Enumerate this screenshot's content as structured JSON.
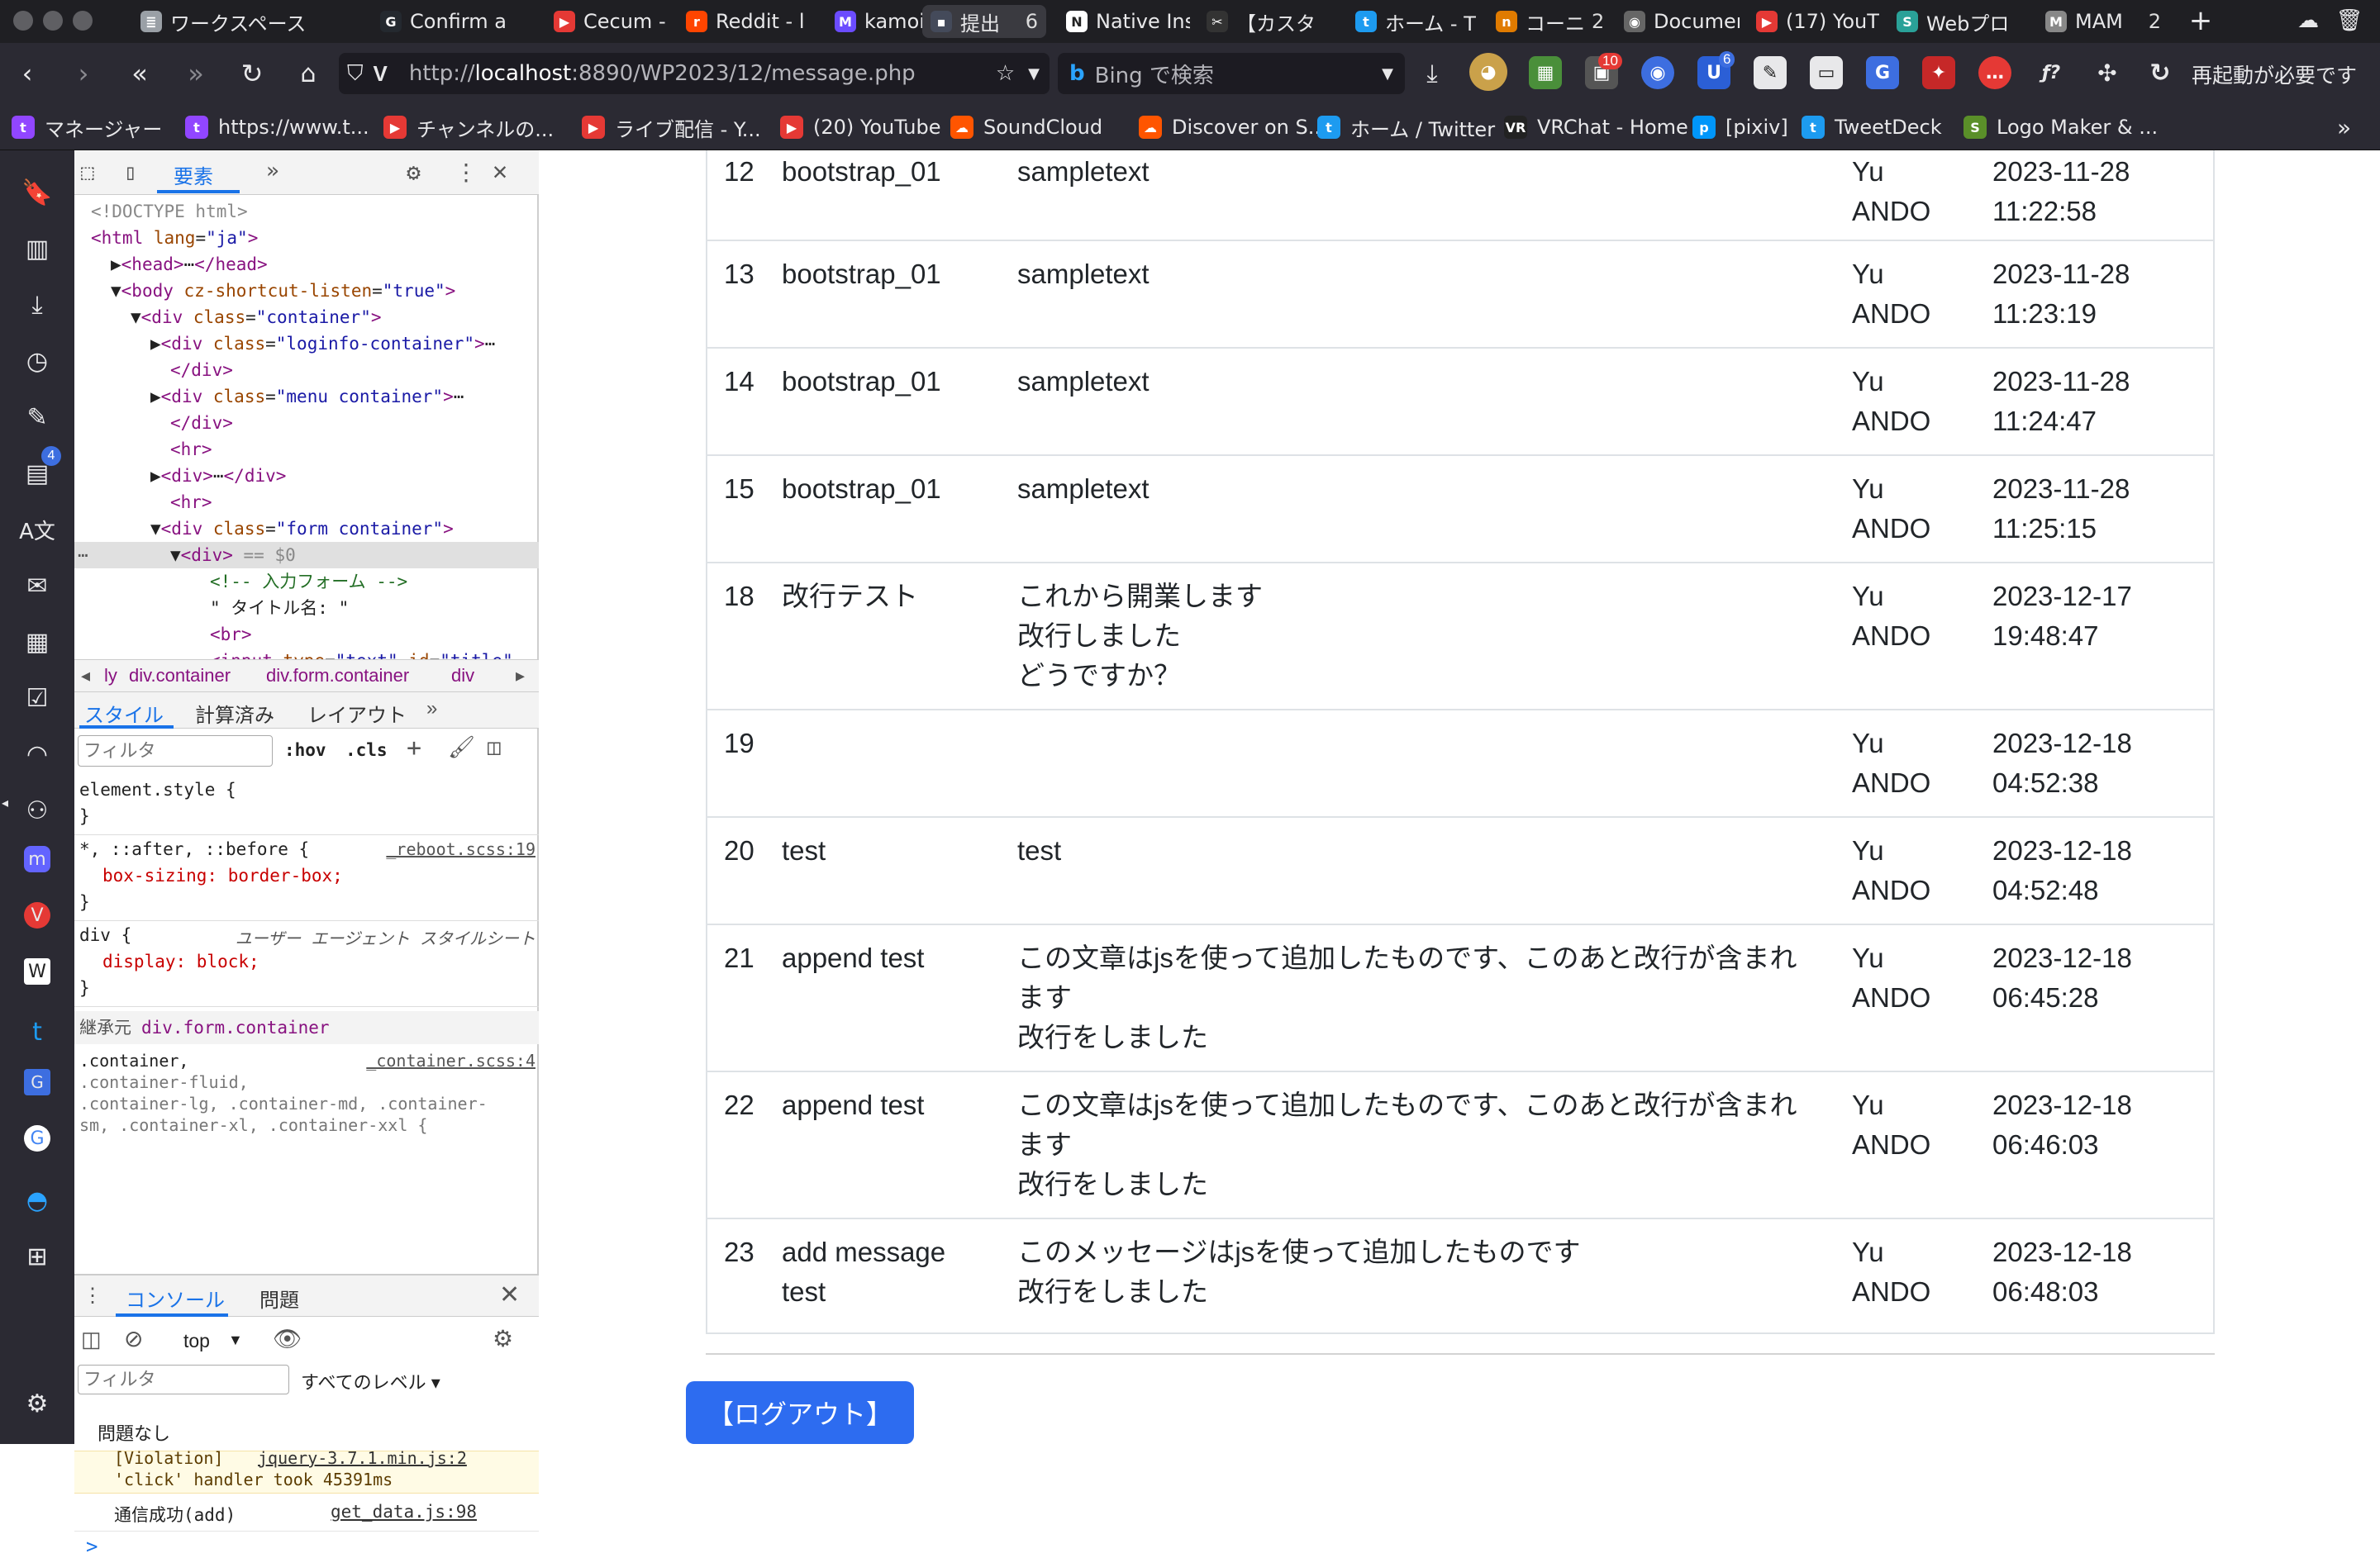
{
  "tabs": [
    {
      "label": "ワークスペース",
      "color": "#9aa0a6",
      "glyph": "≣"
    },
    {
      "label": "Confirm a",
      "color": "#24292f",
      "glyph": "G"
    },
    {
      "label": "Cecum -",
      "color": "#e53935",
      "glyph": "▶"
    },
    {
      "label": "Reddit - l",
      "color": "#ff4500",
      "glyph": "r"
    },
    {
      "label": "kamoi's S",
      "color": "#6b4cff",
      "glyph": "M"
    },
    {
      "label": "提出",
      "count": "6",
      "color": "#444a5a",
      "glyph": "▪",
      "active": true
    },
    {
      "label": "Native Ins",
      "color": "#fff",
      "glyph": "N"
    },
    {
      "label": "【カスタ",
      "color": "#333",
      "glyph": "✂"
    },
    {
      "label": "ホーム - T",
      "color": "#1d9bf0",
      "glyph": "t"
    },
    {
      "label": "コーニ",
      "count": "2",
      "color": "#e07b00",
      "glyph": "n"
    },
    {
      "label": "Documen",
      "color": "#666",
      "glyph": "◉"
    },
    {
      "label": "(17) YouT",
      "color": "#e53935",
      "glyph": "▶"
    },
    {
      "label": "Webプロ",
      "color": "#2aa198",
      "glyph": "S"
    },
    {
      "label": "MAM",
      "count": "2",
      "color": "#888",
      "glyph": "M"
    }
  ],
  "toolbar": {
    "url_prefix": "http://",
    "url_host": "localhost",
    "url_rest": ":8890/WP2023/12/message.php",
    "search_placeholder": "Bing で検索",
    "restart_label": "再起動が必要です",
    "ext_badges": {
      "notif": "10",
      "ublock": "6"
    }
  },
  "bookmarks": [
    {
      "label": "マネージャー",
      "color": "#9146ff",
      "glyph": "t"
    },
    {
      "label": "https://www.t...",
      "color": "#9146ff",
      "glyph": "t"
    },
    {
      "label": "チャンネルの...",
      "color": "#e53935",
      "glyph": "▶"
    },
    {
      "label": "ライブ配信 - Y...",
      "color": "#e53935",
      "glyph": "▶"
    },
    {
      "label": "(20) YouTube",
      "color": "#e53935",
      "glyph": "▶"
    },
    {
      "label": "SoundCloud",
      "color": "#ff5500",
      "glyph": "☁"
    },
    {
      "label": "Discover on S...",
      "color": "#ff5500",
      "glyph": "☁"
    },
    {
      "label": "ホーム / Twitter",
      "color": "#1d9bf0",
      "glyph": "t"
    },
    {
      "label": "VRChat - Home",
      "color": "#222",
      "glyph": "VR"
    },
    {
      "label": "[pixiv]",
      "color": "#0096fa",
      "glyph": "p"
    },
    {
      "label": "TweetDeck",
      "color": "#1d9bf0",
      "glyph": "t"
    },
    {
      "label": "Logo Maker & ...",
      "color": "#5a8f29",
      "glyph": "S"
    }
  ],
  "sidebar": {
    "badge": "4"
  },
  "devtools": {
    "tab_elements": "要素",
    "dom": [
      {
        "indent": 0,
        "html": "<span class='cm' style='color:#888'>&lt;!DOCTYPE html&gt;</span>"
      },
      {
        "indent": 0,
        "html": "<span class='tag'>&lt;html</span> <span class='attr'>lang</span>=<span class='val'>\"ja\"</span><span class='tag'>&gt;</span>"
      },
      {
        "indent": 1,
        "html": "▶<span class='tag'>&lt;head&gt;</span>⋯<span class='tag'>&lt;/head&gt;</span>"
      },
      {
        "indent": 1,
        "html": "▼<span class='tag'>&lt;body</span> <span class='attr'>cz-shortcut-listen</span>=<span class='val'>\"true\"</span><span class='tag'>&gt;</span>"
      },
      {
        "indent": 2,
        "html": "▼<span class='tag'>&lt;div</span> <span class='attr'>class</span>=<span class='val'>\"container\"</span><span class='tag'>&gt;</span>"
      },
      {
        "indent": 3,
        "html": "▶<span class='tag'>&lt;div</span> <span class='attr'>class</span>=<span class='val'>\"loginfo-container\"</span><span class='tag'>&gt;</span>⋯"
      },
      {
        "indent": 4,
        "html": "<span class='tag'>&lt;/div&gt;</span>"
      },
      {
        "indent": 3,
        "html": "▶<span class='tag'>&lt;div</span> <span class='attr'>class</span>=<span class='val'>\"menu container\"</span><span class='tag'>&gt;</span>⋯"
      },
      {
        "indent": 4,
        "html": "<span class='tag'>&lt;/div&gt;</span>"
      },
      {
        "indent": 4,
        "html": "<span class='tag'>&lt;hr&gt;</span>"
      },
      {
        "indent": 3,
        "html": "▶<span class='tag'>&lt;div&gt;</span>⋯<span class='tag'>&lt;/div&gt;</span>"
      },
      {
        "indent": 4,
        "html": "<span class='tag'>&lt;hr&gt;</span>"
      },
      {
        "indent": 3,
        "html": "▼<span class='tag'>&lt;div</span> <span class='attr'>class</span>=<span class='val'>\"form container\"</span><span class='tag'>&gt;</span>"
      },
      {
        "indent": 4,
        "html": "▼<span class='tag'>&lt;div&gt;</span> <span style='color:#888'>== $0</span>",
        "selected": true
      },
      {
        "indent": 6,
        "html": "<span class='cm'>&lt;!-- 入力フォーム --&gt;</span>"
      },
      {
        "indent": 6,
        "html": "\" タイトル名: \""
      },
      {
        "indent": 6,
        "html": "<span class='tag'>&lt;br&gt;</span>"
      },
      {
        "indent": 6,
        "html": "<span class='tag'>&lt;input</span> <span class='attr'>type</span>=<span class='val'>\"text\"</span> <span class='attr'>id</span>=<span class='val'>\"title\"</span>"
      }
    ],
    "breadcrumbs": [
      "ly",
      "div.container",
      "div.form.container",
      "div"
    ],
    "style_tabs": [
      "スタイル",
      "計算済み",
      "レイアウト"
    ],
    "filter_placeholder": "フィルタ",
    "hov": ":hov",
    "cls": ".cls",
    "rules": [
      {
        "sel": "element.style {",
        "src": "",
        "props": [],
        "close": "}"
      },
      {
        "sel": "*, ::after, ::before {",
        "src": "_reboot.scss:19",
        "props": [
          "box-sizing: border-box;"
        ],
        "close": "}"
      },
      {
        "sel": "div {",
        "src": "ユーザー エージェント スタイルシート",
        "props": [
          "display: block;"
        ],
        "close": "}"
      }
    ],
    "inherited_label": "継承元",
    "inherited_from": "div.form.container",
    "container_rule_src": "_container.scss:4",
    "container_rule_lines": [
      ".container,",
      ".container-fluid,",
      ".container-lg, .container-md, .container-",
      "sm, .container-xl, .container-xxl {"
    ],
    "console_tabs": [
      "コンソール",
      "問題"
    ],
    "console_context": "top",
    "console_filter": "フィルタ",
    "console_levels": "すべてのレベル ▾",
    "no_issues": "問題なし",
    "violation_link": "jquery-3.7.1.min.js:2",
    "violation_line1": "[Violation]",
    "violation_line2": "'click' handler took 45391ms",
    "log_text": "通信成功(add)",
    "log_src": "get_data.js:98",
    "prompt": ">"
  },
  "messages": [
    {
      "id": "12",
      "title": "bootstrap_01",
      "message": "sampletext",
      "user": "Yu\nANDO",
      "date": "2023-11-28 11:22:58"
    },
    {
      "id": "13",
      "title": "bootstrap_01",
      "message": "sampletext",
      "user": "Yu\nANDO",
      "date": "2023-11-28 11:23:19"
    },
    {
      "id": "14",
      "title": "bootstrap_01",
      "message": "sampletext",
      "user": "Yu\nANDO",
      "date": "2023-11-28 11:24:47"
    },
    {
      "id": "15",
      "title": "bootstrap_01",
      "message": "sampletext",
      "user": "Yu\nANDO",
      "date": "2023-11-28 11:25:15"
    },
    {
      "id": "18",
      "title": "改行テスト",
      "message": "これから開業します\n改行しました\nどうですか？",
      "user": "Yu\nANDO",
      "date": "2023-12-17\n19:48:47"
    },
    {
      "id": "19",
      "title": "",
      "message": "",
      "user": "Yu\nANDO",
      "date": "2023-12-18\n04:52:38"
    },
    {
      "id": "20",
      "title": "test",
      "message": "test",
      "user": "Yu\nANDO",
      "date": "2023-12-18\n04:52:48"
    },
    {
      "id": "21",
      "title": "append test",
      "message": "この文章はjsを使って追加したものです、このあと改行が含まれ\nます\n改行をしました",
      "user": "Yu\nANDO",
      "date": "2023-12-18\n06:45:28"
    },
    {
      "id": "22",
      "title": "append test",
      "message": "この文章はjsを使って追加したものです、このあと改行が含まれ\nます\n改行をしました",
      "user": "Yu\nANDO",
      "date": "2023-12-18\n06:46:03"
    },
    {
      "id": "23",
      "title": "add message\ntest",
      "message": "このメッセージはjsを使って追加したものです\n改行をしました",
      "user": "Yu\nANDO",
      "date": "2023-12-18\n06:48:03"
    }
  ],
  "logout_label": "【ログアウト】"
}
